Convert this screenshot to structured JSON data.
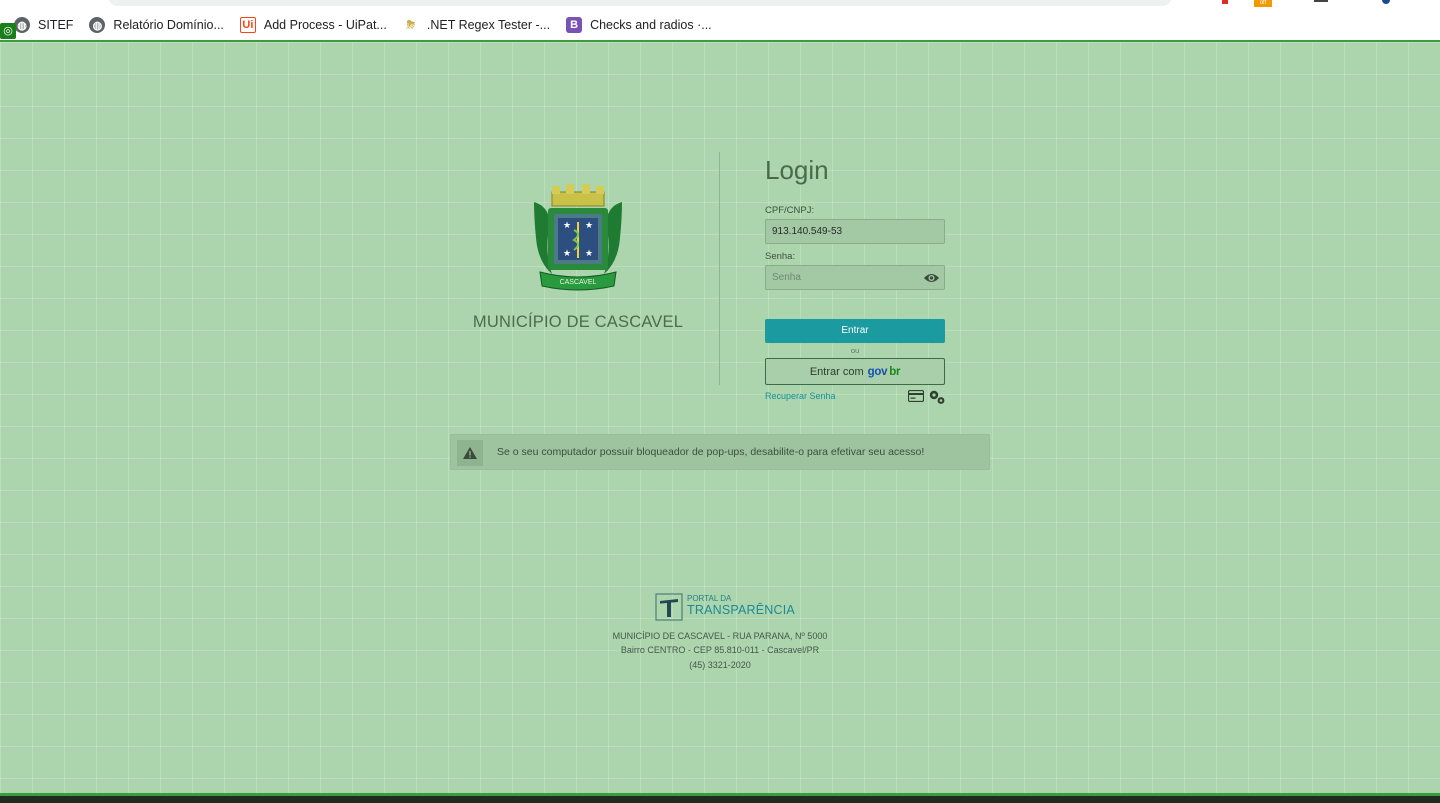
{
  "browser": {
    "bookmarks": [
      {
        "label": "SITEF",
        "icon": "globe-icon"
      },
      {
        "label": "Relatório Domínio...",
        "icon": "globe-icon"
      },
      {
        "label": "Add Process - UiPat...",
        "icon": "uipath-icon"
      },
      {
        "label": ".NET Regex Tester -...",
        "icon": "regex-icon"
      },
      {
        "label": "Checks and radios ·...",
        "icon": "bootstrap-icon"
      }
    ],
    "extension_badge_text": "off"
  },
  "org": {
    "name": "MUNICÍPIO DE CASCAVEL",
    "crest_ribbon": "CASCAVEL"
  },
  "login": {
    "title": "Login",
    "cpf_label": "CPF/CNPJ:",
    "cpf_value": "913.140.549-53",
    "senha_label": "Senha:",
    "senha_placeholder": "Senha",
    "entrar_button": "Entrar",
    "or_text": "ou",
    "gov_button_prefix": "Entrar com",
    "gov_logo": {
      "g": "gov",
      "dot": ".",
      "br": "br"
    },
    "recover_link": "Recuperar Senha"
  },
  "alert": {
    "message": "Se o seu computador possuir bloqueador de pop-ups, desabilite-o para efetivar seu acesso!"
  },
  "footer": {
    "portal_small": "PORTAL DA",
    "portal_big": "TRANSPARÊNCIA",
    "address_line1": "MUNICÍPIO DE CASCAVEL - RUA PARANA, Nº 5000",
    "address_line2": "Bairro CENTRO - CEP 85.810-011 - Cascavel/PR",
    "phone": "(45) 3321-2020"
  },
  "colors": {
    "background": "#acd5ad",
    "primary_button": "#1b9aa0",
    "link": "#1b8f95",
    "gov_blue": "#1351b4",
    "gov_yellow": "#f8bf1a",
    "gov_green": "#168821"
  }
}
